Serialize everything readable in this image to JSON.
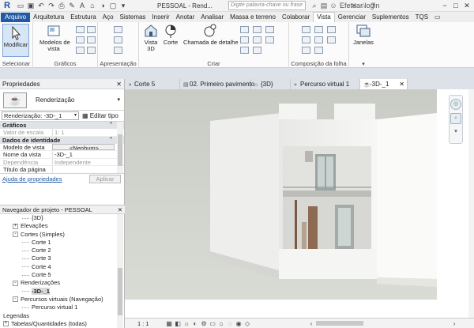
{
  "app": {
    "logo": "R",
    "title": "PESSOAL - Rend...",
    "search_placeholder": "Digite palavra-chave ou frase",
    "login": "Efetuar login"
  },
  "quick_access": [
    "open-icon",
    "save-icon",
    "undo-icon",
    "redo-icon",
    "print-icon",
    "measure-icon",
    "text-icon"
  ],
  "ribbon_tabs": [
    "Arquivo",
    "Arquitetura",
    "Estrutura",
    "Aço",
    "Sistemas",
    "Inserir",
    "Anotar",
    "Analisar",
    "Massa e terreno",
    "Colaborar",
    "Vista",
    "Gerenciar",
    "Suplementos",
    "TQS"
  ],
  "active_tab": "Vista",
  "ribbon": {
    "selecionar": {
      "button": "Modificar",
      "label": "Selecionar"
    },
    "graficos": {
      "button1": "Modelos de",
      "button2": "vista",
      "label": "Gráficos"
    },
    "apresentacao": {
      "label": "Apresentação"
    },
    "criar": {
      "vista3d_1": "Vista",
      "vista3d_2": "3D",
      "corte": "Corte",
      "chamada": "Chamada de detalhe",
      "label": "Criar"
    },
    "composicao": {
      "label": "Composição da folha"
    },
    "janelas": {
      "button": "Janelas",
      "label": ""
    }
  },
  "properties": {
    "header": "Propriedades",
    "type_name": "Renderização",
    "selector": "Renderização: -3D-_1",
    "edit_type": "Editar tipo",
    "sections": [
      {
        "name": "Gráficos"
      },
      {
        "name": "Dados de identidade"
      }
    ],
    "rows": {
      "valor_escala": {
        "k": "Valor de escala",
        "prefix": "1:",
        "v": "1"
      },
      "modelo_vista": {
        "k": "Modelo de vista",
        "v": "<Nenhum>"
      },
      "nome_vista": {
        "k": "Nome da vista",
        "v": "-3D-_1"
      },
      "dependencia": {
        "k": "Dependência",
        "v": "Independente"
      },
      "titulo": {
        "k": "Título da página",
        "v": ""
      }
    },
    "help_link": "Ajuda de propriedades",
    "apply": "Aplicar"
  },
  "browser": {
    "header": "Navegador de projeto - PESSOAL",
    "nodes": [
      {
        "t": "{3D}",
        "lvl": 2,
        "pm": ""
      },
      {
        "t": "Elevações",
        "lvl": 1,
        "pm": "+"
      },
      {
        "t": "Cortes (Simples)",
        "lvl": 1,
        "pm": "-"
      },
      {
        "t": "Corte 1",
        "lvl": 2,
        "pm": ""
      },
      {
        "t": "Corte 2",
        "lvl": 2,
        "pm": ""
      },
      {
        "t": "Corte 3",
        "lvl": 2,
        "pm": ""
      },
      {
        "t": "Corte 4",
        "lvl": 2,
        "pm": ""
      },
      {
        "t": "Corte 5",
        "lvl": 2,
        "pm": ""
      },
      {
        "t": "Renderizações",
        "lvl": 1,
        "pm": "-"
      },
      {
        "t": "-3D-_1",
        "lvl": 2,
        "pm": "",
        "sel": true
      },
      {
        "t": "Percursos virtuais (Navegação)",
        "lvl": 1,
        "pm": "-"
      },
      {
        "t": "Percurso virtual 1",
        "lvl": 2,
        "pm": ""
      },
      {
        "t": "Legendas",
        "lvl": 0,
        "pm": ""
      },
      {
        "t": "Tabelas/Quantidades (todas)",
        "lvl": 0,
        "pm": "+"
      }
    ]
  },
  "view_tabs": [
    {
      "t": "Corte 5",
      "icon": "section-icon"
    },
    {
      "t": "02. Primeiro pavimento",
      "icon": "floorplan-icon"
    },
    {
      "t": "{3D}",
      "icon": "3d-view-icon"
    },
    {
      "t": "Percurso virtual 1",
      "icon": "walkthrough-icon"
    },
    {
      "t": "-3D-_1",
      "icon": "render-icon",
      "active": true
    }
  ],
  "view_bar": {
    "scale": "1 : 1"
  }
}
